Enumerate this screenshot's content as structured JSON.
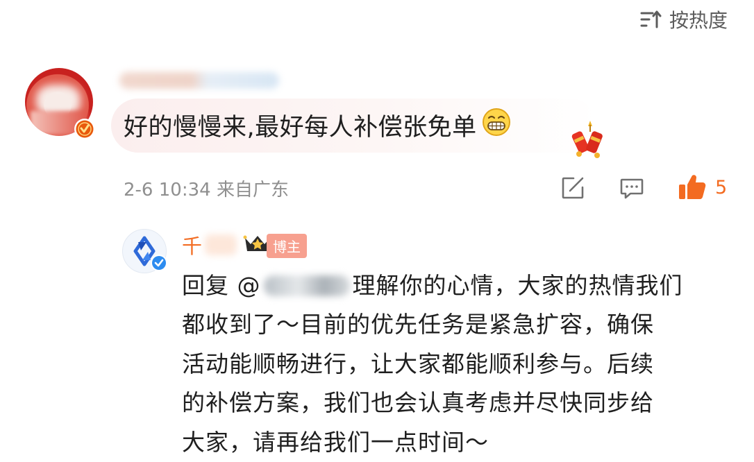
{
  "sort": {
    "label": "按热度",
    "icon": "sort-icon"
  },
  "comment": {
    "avatar_icon": "user-avatar",
    "badge_icon": "verified-badge-icon",
    "badge_color": "#e8590c",
    "text": "好的慢慢来,最好每人补偿张免单",
    "emoji_icon": "grin-emoji-icon",
    "decoration_icon": "firecracker-sticker-icon",
    "date": "2-6 10:34",
    "location": "来自广东",
    "share_icon": "share-icon",
    "reply_icon": "comment-icon",
    "like_icon": "thumbs-up-icon",
    "like_count": "5",
    "like_color": "#f36b21"
  },
  "reply": {
    "avatar_icon": "brand-logo-avatar",
    "verified_icon": "blue-verified-icon",
    "name": "千",
    "crown_icon": "crown-icon",
    "badge": "博主",
    "prefix": "回复 @",
    "lines": [
      "理解你的心情，大家的热情我们",
      "都收到了～目前的优先任务是紧急扩容，确保",
      "活动能顺畅进行，让大家都能顺利参与。后续",
      "的补偿方案，我们也会认真考虑并尽快同步给",
      "大家，请再给我们一点时间～"
    ],
    "name_color": "#f26d24",
    "badge_color": "#f7a08f"
  }
}
